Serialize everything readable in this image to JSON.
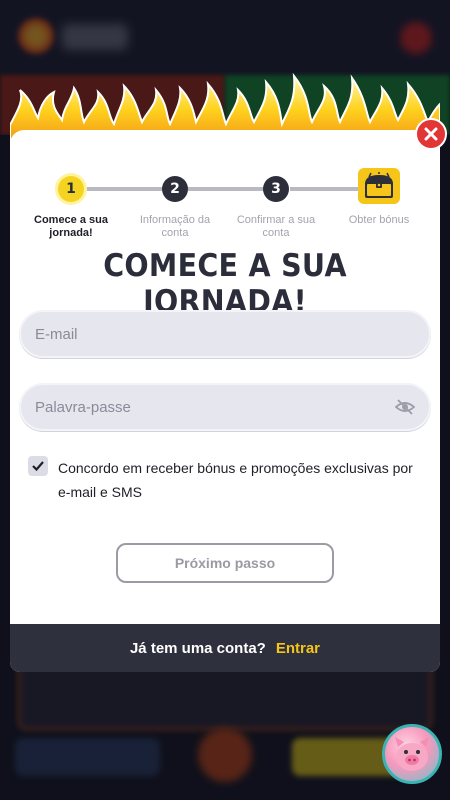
{
  "modal": {
    "title": "COMECE A SUA JORNADA!",
    "steps": [
      {
        "number": "1",
        "label": "Comece a sua jornada!",
        "state": "active"
      },
      {
        "number": "2",
        "label": "Informação da conta",
        "state": "inactive"
      },
      {
        "number": "3",
        "label": "Confirmar a sua conta",
        "state": "inactive"
      },
      {
        "number": "",
        "label": "Obter bónus",
        "state": "inactive",
        "icon": "treasure-chest-icon"
      }
    ],
    "email_placeholder": "E-mail",
    "password_placeholder": "Palavra-passe",
    "consent": {
      "checked": true,
      "text": "Concordo em receber bónus e promoções exclusivas por e-mail e SMS"
    },
    "next_button": "Próximo passo",
    "footer": {
      "prompt": "Já tem uma conta?",
      "login_link": "Entrar"
    }
  },
  "colors": {
    "accent_yellow": "#f5d421",
    "link_yellow": "#f5c518",
    "close_red": "#e23636",
    "dark": "#2e303d"
  },
  "icons": {
    "close": "close-icon",
    "password_toggle": "eye-slash-icon",
    "checkbox": "checkmark-icon",
    "bonus": "treasure-chest-icon",
    "chat": "pig-mascot-icon"
  }
}
